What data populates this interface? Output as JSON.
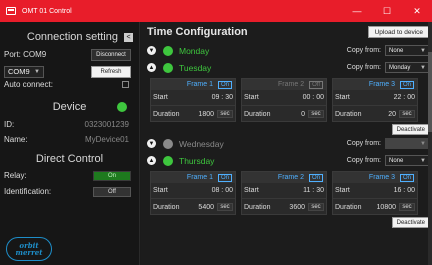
{
  "window": {
    "title": "OMT 01 Control",
    "minimize": "—",
    "maximize": "☐",
    "close": "✕"
  },
  "connection": {
    "heading": "Connection setting",
    "collapse_glyph": "<",
    "port_label": "Port: COM9",
    "disconnect_label": "Disconnect",
    "port_select": "COM9",
    "refresh_label": "Refresh",
    "auto_connect_label": "Auto connect:"
  },
  "device": {
    "heading": "Device",
    "status_color": "#3ec63e",
    "id_label": "ID:",
    "id_value": "0323001239",
    "name_label": "Name:",
    "name_value": "MyDevice01"
  },
  "direct_control": {
    "heading": "Direct Control",
    "relay_label": "Relay:",
    "relay_state": "On",
    "identification_label": "Identification:",
    "identification_state": "Off"
  },
  "logo": {
    "line1": "orbit",
    "line2": "merret"
  },
  "main": {
    "title": "Time Configuration",
    "upload_label": "Upload to device",
    "copy_label": "Copy from:",
    "start_label": "Start",
    "duration_label": "Duration",
    "sec_unit": "sec",
    "deactivate_label": "Deactivate",
    "colors": {
      "active": "#3ec63e",
      "inactive": "#8a8a8a",
      "frame_on": "#4fb0ff",
      "frame_off": "#777777"
    },
    "days": [
      {
        "name": "Monday",
        "copy_from": "None"
      },
      {
        "name": "Tuesday",
        "copy_from": "Monday",
        "frames": [
          {
            "name": "Frame 1",
            "state": "On",
            "start_h": "09",
            "start_m": "30",
            "duration": "1800"
          },
          {
            "name": "Frame 2",
            "state": "Off",
            "start_h": "00",
            "start_m": "00",
            "duration": "0"
          },
          {
            "name": "Frame 3",
            "state": "On",
            "start_h": "22",
            "start_m": "00",
            "duration": "20"
          }
        ]
      },
      {
        "name": "Wednesday",
        "copy_from": ""
      },
      {
        "name": "Thursday",
        "copy_from": "None",
        "frames": [
          {
            "name": "Frame 1",
            "state": "On",
            "start_h": "08",
            "start_m": "00",
            "duration": "5400"
          },
          {
            "name": "Frame 2",
            "state": "On",
            "start_h": "11",
            "start_m": "30",
            "duration": "3600"
          },
          {
            "name": "Frame 3",
            "state": "On",
            "start_h": "16",
            "start_m": "00",
            "duration": "10800"
          }
        ]
      }
    ]
  }
}
